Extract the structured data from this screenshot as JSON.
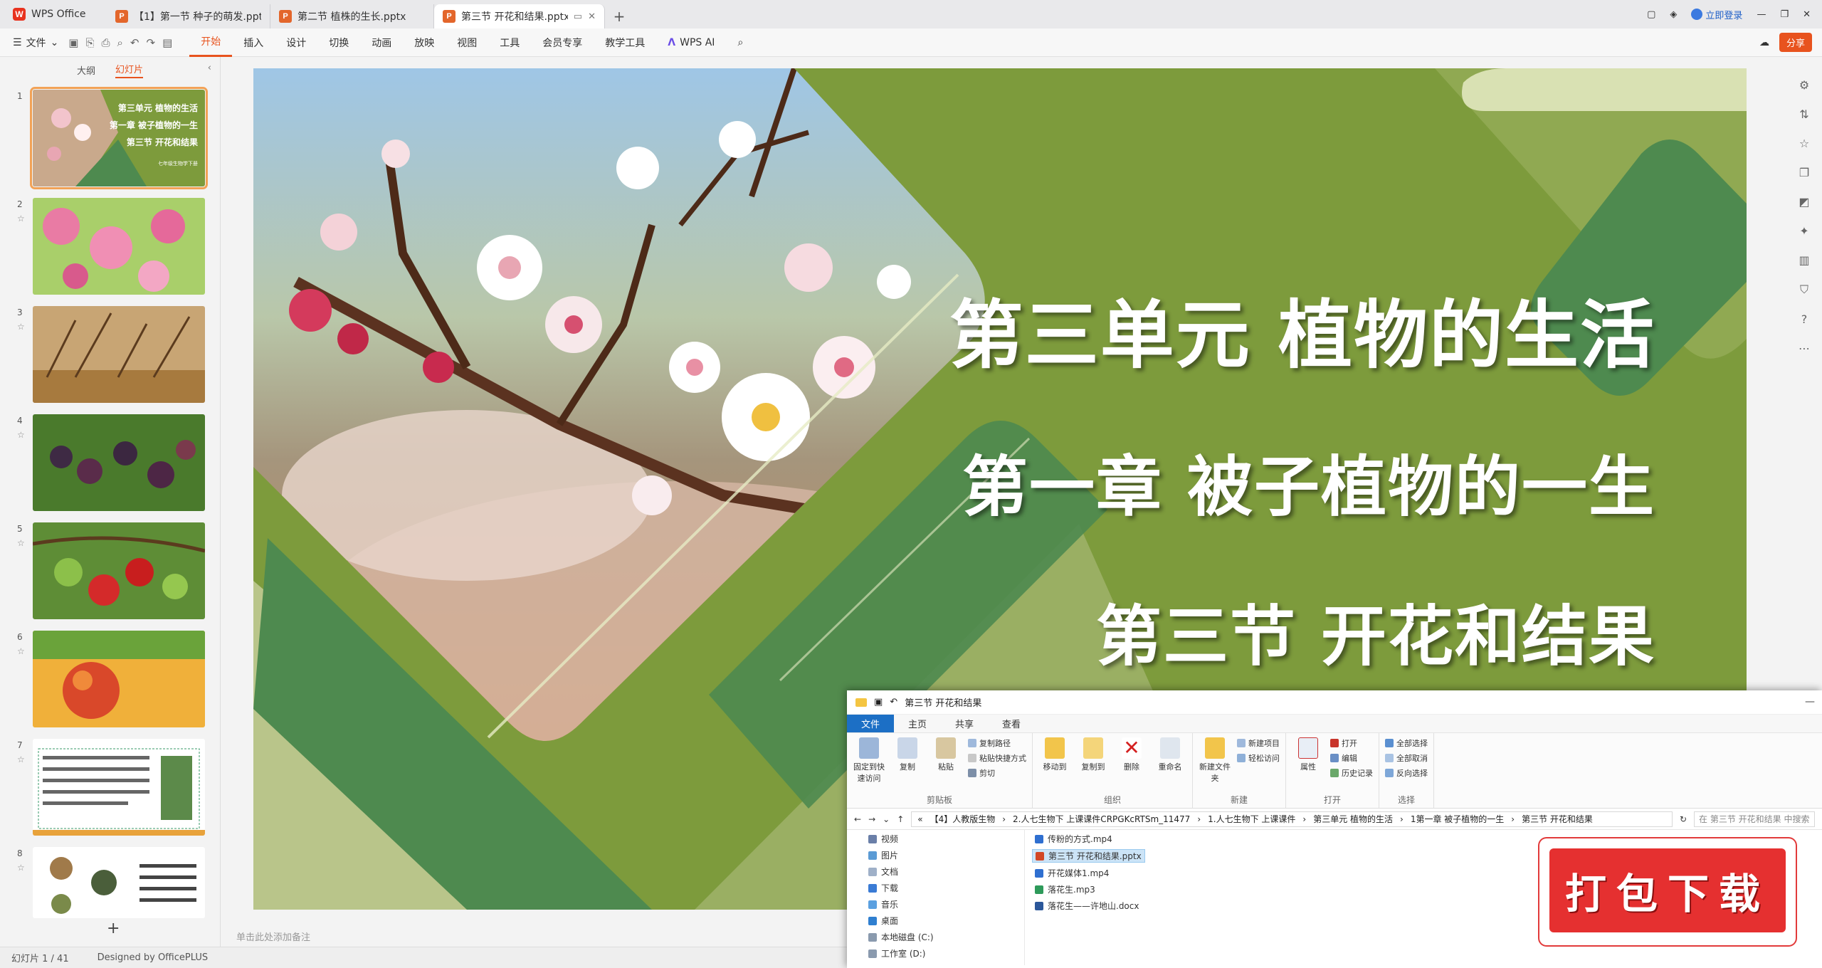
{
  "app": {
    "name": "WPS Office"
  },
  "tabs": [
    {
      "label": "【1】第一节 种子的萌发.pptx",
      "active": false
    },
    {
      "label": "第二节 植株的生长.pptx",
      "active": false
    },
    {
      "label": "第三节 开花和结果.pptx",
      "active": true
    }
  ],
  "titlebar": {
    "login": "立即登录"
  },
  "menu": {
    "file": "文件",
    "items": [
      "开始",
      "插入",
      "设计",
      "切换",
      "动画",
      "放映",
      "视图",
      "工具",
      "会员专享",
      "教学工具"
    ],
    "active_index": 0,
    "wps_ai": "WPS AI",
    "share": "分享"
  },
  "left_panel": {
    "tabs": [
      "大纲",
      "幻灯片"
    ],
    "active_tab": 1,
    "slides": [
      {
        "num": "1",
        "title_lines": [
          "第三单元 植物的生活",
          "第一章 被子植物的一生",
          "第三节 开花和结果"
        ],
        "footer": "七年级生物学下册"
      },
      {
        "num": "2"
      },
      {
        "num": "3"
      },
      {
        "num": "4"
      },
      {
        "num": "5"
      },
      {
        "num": "6"
      },
      {
        "num": "7"
      },
      {
        "num": "8"
      }
    ],
    "add_label": "+"
  },
  "slide": {
    "title1": "第三单元 植物的生活",
    "title2": "第一章 被子植物的一生",
    "title3": "第三节 开花和结果",
    "colors": {
      "primary_green": "#7d9b3c",
      "dark_green": "#4e8a4f",
      "light_green": "#c5cf8d"
    }
  },
  "notes_hint": "单击此处添加备注",
  "statusbar": {
    "slide_info": "幻灯片 1 / 41",
    "design": "Designed by OfficePLUS"
  },
  "explorer": {
    "title": "第三节 开花和结果",
    "tabs": [
      "文件",
      "主页",
      "共享",
      "查看"
    ],
    "groups": {
      "clipboard": {
        "label": "剪贴板",
        "pin": "固定到快速访问",
        "copy": "复制",
        "paste": "粘贴",
        "copy_path": "复制路径",
        "paste_shortcut": "粘贴快捷方式",
        "cut": "剪切"
      },
      "organize": {
        "label": "组织",
        "move_to": "移动到",
        "copy_to": "复制到",
        "delete": "删除",
        "rename": "重命名"
      },
      "new": {
        "label": "新建",
        "new_folder": "新建文件夹",
        "new_item": "新建项目",
        "easy_access": "轻松访问"
      },
      "open": {
        "label": "打开",
        "properties": "属性",
        "open": "打开",
        "edit": "编辑",
        "history": "历史记录"
      },
      "select": {
        "label": "选择",
        "select_all": "全部选择",
        "select_none": "全部取消",
        "invert": "反向选择"
      }
    },
    "path": [
      "«",
      "【4】人教版生物",
      "2.人七生物下 上课课件CRPGKcRTSm_11477",
      "1.人七生物下 上课课件",
      "第三单元 植物的生活",
      "1第一章 被子植物的一生",
      "第三节 开花和结果"
    ],
    "search_placeholder": "在 第三节 开花和结果 中搜索",
    "nav": [
      "视频",
      "图片",
      "文档",
      "下载",
      "音乐",
      "桌面",
      "本地磁盘 (C:)",
      "工作室 (D:)"
    ],
    "files": [
      {
        "name": "传粉的方式.mp4",
        "type": "video"
      },
      {
        "name": "第三节 开花和结果.pptx",
        "type": "ppt",
        "selected": true
      },
      {
        "name": "开花媒体1.mp4",
        "type": "video"
      },
      {
        "name": "落花生.mp3",
        "type": "audio"
      },
      {
        "name": "落花生——许地山.docx",
        "type": "doc"
      }
    ]
  },
  "download_badge": "打包下载"
}
